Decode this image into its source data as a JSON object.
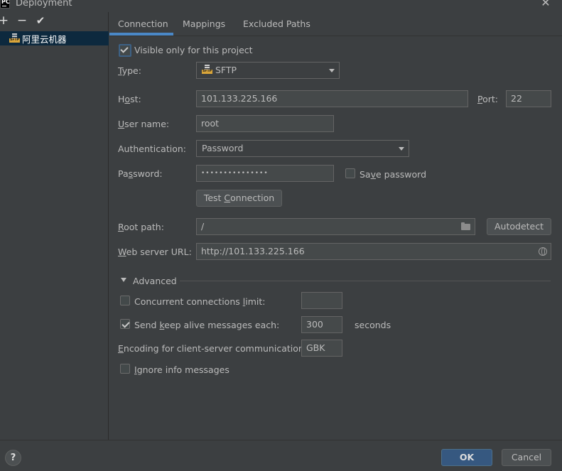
{
  "window": {
    "title": "Deployment",
    "app_icon": "PC",
    "close_symbol": "✕"
  },
  "toolbar": {
    "add": "+",
    "remove": "−",
    "apply": "✔"
  },
  "servers": [
    {
      "label": "阿里云机器",
      "icon": "sftp-server-icon",
      "icon_text": "SFTP"
    }
  ],
  "tabs": [
    {
      "label": "Connection",
      "active": true
    },
    {
      "label": "Mappings",
      "active": false
    },
    {
      "label": "Excluded Paths",
      "active": false
    }
  ],
  "connection": {
    "visible_only": {
      "label": "Visible only for this project",
      "checked": true
    },
    "type": {
      "label_pre": "",
      "label_u": "T",
      "label_post": "ype:",
      "value": "SFTP",
      "icon_text": "SFTP"
    },
    "host": {
      "label_pre": "H",
      "label_u": "o",
      "label_post": "st:",
      "value": "101.133.225.166"
    },
    "port": {
      "label_pre": "",
      "label_u": "P",
      "label_post": "ort:",
      "value": "22"
    },
    "user": {
      "label_pre": "",
      "label_u": "U",
      "label_post": "ser name:",
      "value": "root"
    },
    "auth": {
      "label": "Authentication:",
      "value": "Password"
    },
    "password": {
      "label_pre": "Pa",
      "label_u": "s",
      "label_post": "sword:",
      "value": "•••••••••••••••"
    },
    "save_password": {
      "label_pre": "Sa",
      "label_u": "v",
      "label_post": "e password",
      "checked": false
    },
    "test_button": {
      "label_pre": "Test ",
      "label_u": "C",
      "label_post": "onnection"
    },
    "root_path": {
      "label_pre": "",
      "label_u": "R",
      "label_post": "oot path:",
      "value": "/"
    },
    "autodetect_button": "Autodetect",
    "web_url": {
      "label_pre": "",
      "label_u": "W",
      "label_post": "eb server URL:",
      "value": "http://101.133.225.166"
    }
  },
  "advanced": {
    "title": "Advanced",
    "concurrent": {
      "label_pre": "Concurrent connections ",
      "label_u": "l",
      "label_post": "imit:",
      "checked": false,
      "value": ""
    },
    "keepalive": {
      "label_pre": "Send ",
      "label_u": "k",
      "label_post": "eep alive messages each:",
      "checked": true,
      "value": "300",
      "unit": "seconds"
    },
    "encoding": {
      "label_pre": "",
      "label_u": "E",
      "label_post": "ncoding for client-server communication:",
      "value": "GBK"
    },
    "ignore_info": {
      "label_pre": "",
      "label_u": "I",
      "label_post": "gnore info messages",
      "checked": false
    }
  },
  "footer": {
    "help": "?",
    "ok": "OK",
    "cancel": "Cancel"
  },
  "colors": {
    "accent": "#4a88c7",
    "primary_button": "#365880",
    "selection": "#0d293e",
    "background": "#3c3f41"
  }
}
